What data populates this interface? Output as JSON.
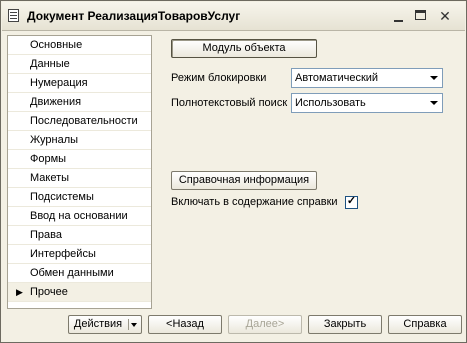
{
  "window": {
    "title": "Документ РеализацияТоваровУслуг",
    "controls": {
      "minimize": "minimize-icon",
      "maximize": "maximize-icon",
      "close": "close-icon"
    }
  },
  "sidebar": {
    "items": [
      {
        "label": "Основные"
      },
      {
        "label": "Данные"
      },
      {
        "label": "Нумерация"
      },
      {
        "label": "Движения"
      },
      {
        "label": "Последовательности"
      },
      {
        "label": "Журналы"
      },
      {
        "label": "Формы"
      },
      {
        "label": "Макеты"
      },
      {
        "label": "Подсистемы"
      },
      {
        "label": "Ввод на основании"
      },
      {
        "label": "Права"
      },
      {
        "label": "Интерфейсы"
      },
      {
        "label": "Обмен данными"
      },
      {
        "label": "Прочее",
        "active": true
      }
    ],
    "active_marker": "▶"
  },
  "main": {
    "module_button": "Модуль объекта",
    "lock_mode": {
      "label": "Режим блокировки",
      "value": "Автоматический"
    },
    "fulltext_search": {
      "label": "Полнотекстовый поиск",
      "value": "Использовать"
    },
    "help_button": "Справочная информация",
    "include_help": {
      "label": "Включать в содержание справки",
      "checked": true,
      "mark": "✓"
    }
  },
  "footer": {
    "actions": "Действия",
    "back": "<Назад",
    "next": "Далее>",
    "close": "Закрыть",
    "help": "Справка"
  }
}
